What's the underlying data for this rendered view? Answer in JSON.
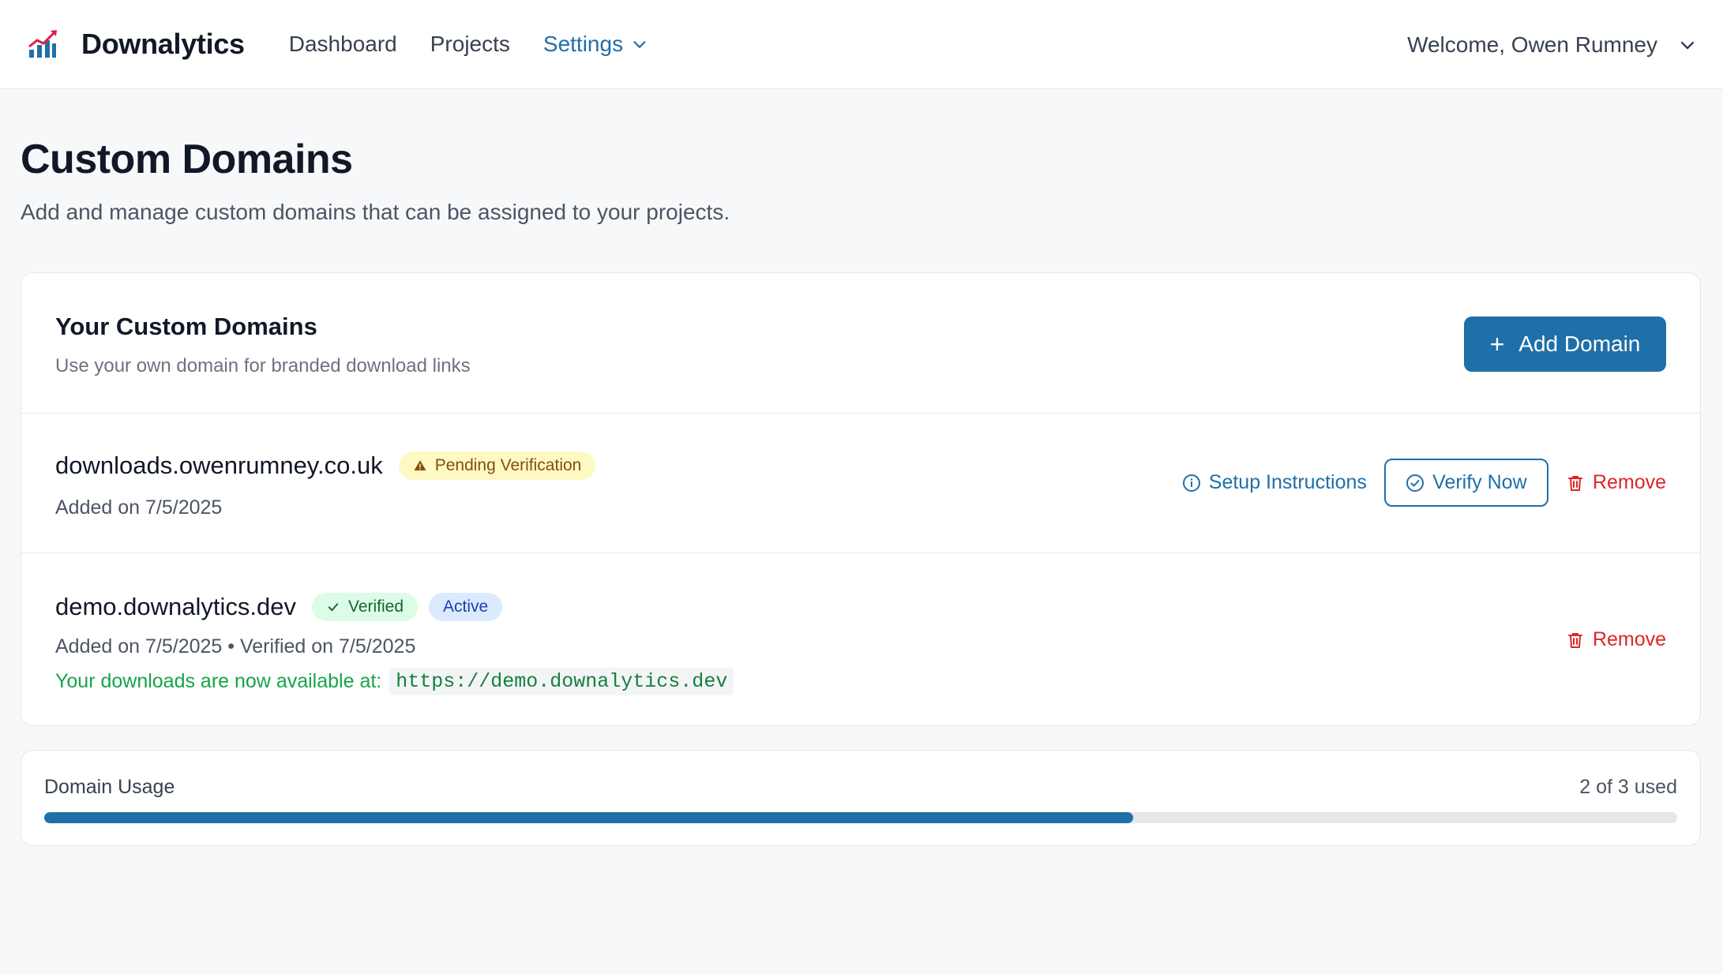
{
  "app": {
    "name": "Downalytics",
    "logo_icon": "chart-logo-icon"
  },
  "nav": {
    "items": [
      {
        "label": "Dashboard",
        "active": false
      },
      {
        "label": "Projects",
        "active": false
      },
      {
        "label": "Settings",
        "active": true
      }
    ]
  },
  "user": {
    "welcome": "Welcome, Owen Rumney"
  },
  "page": {
    "title": "Custom Domains",
    "subtitle": "Add and manage custom domains that can be assigned to your projects."
  },
  "domains_card": {
    "title": "Your Custom Domains",
    "subtitle": "Use your own domain for branded download links",
    "add_button": "Add Domain",
    "domains": [
      {
        "name": "downloads.owenrumney.co.uk",
        "status_badge": "Pending Verification",
        "meta": "Added on 7/5/2025",
        "setup_label": "Setup Instructions",
        "verify_label": "Verify Now",
        "remove_label": "Remove"
      },
      {
        "name": "demo.downalytics.dev",
        "status_badge": "Verified",
        "active_badge": "Active",
        "meta": "Added on 7/5/2025 • Verified on 7/5/2025",
        "available_text": "Your downloads are now available at:",
        "url": "https://demo.downalytics.dev",
        "remove_label": "Remove"
      }
    ]
  },
  "usage": {
    "label": "Domain Usage",
    "count_text": "2 of 3 used",
    "used": 2,
    "total": 3
  },
  "colors": {
    "accent": "#1f6fa8",
    "danger": "#dc2626",
    "success": "#16a34a",
    "pending_bg": "#fef9c3"
  }
}
